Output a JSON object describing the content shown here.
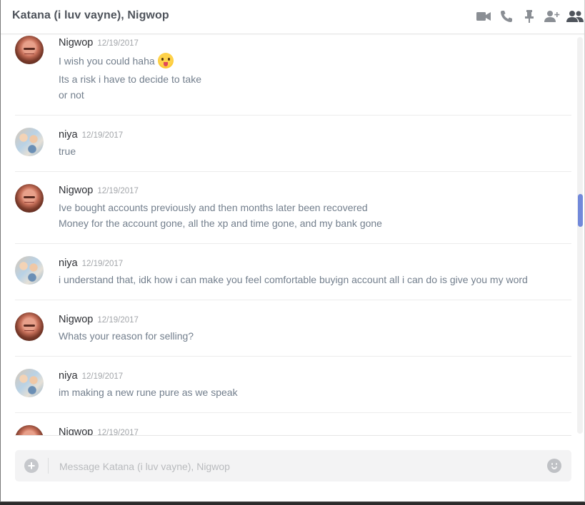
{
  "header": {
    "title": "Katana (i luv vayne), Nigwop",
    "icons": [
      "video-call-icon",
      "voice-call-icon",
      "pin-icon",
      "add-friend-icon",
      "members-icon"
    ]
  },
  "messages": [
    {
      "author": "Nigwop",
      "timestamp": "12/19/2017",
      "avatar": "nigwop",
      "lines": [
        "I wish you could haha",
        "Its a risk i have to decide to take",
        "or not"
      ],
      "emoji": "stuck-out-tongue-emoji"
    },
    {
      "author": "niya",
      "timestamp": "12/19/2017",
      "avatar": "niya",
      "lines": [
        "true"
      ]
    },
    {
      "author": "Nigwop",
      "timestamp": "12/19/2017",
      "avatar": "nigwop",
      "lines": [
        "Ive bought accounts previously and then months later been recovered",
        "Money for the account gone, all the xp and time gone, and my bank gone"
      ]
    },
    {
      "author": "niya",
      "timestamp": "12/19/2017",
      "avatar": "niya",
      "lines": [
        "i understand that, idk how i can make you feel comfortable buyign account all i can do is give you my word"
      ]
    },
    {
      "author": "Nigwop",
      "timestamp": "12/19/2017",
      "avatar": "nigwop",
      "lines": [
        "Whats your reason for selling?"
      ]
    },
    {
      "author": "niya",
      "timestamp": "12/19/2017",
      "avatar": "niya",
      "lines": [
        "im making a new rune pure as we speak"
      ]
    },
    {
      "author": "Nigwop",
      "timestamp": "12/19/2017",
      "avatar": "nigwop",
      "lines": []
    }
  ],
  "composer": {
    "placeholder": "Message Katana (i luv vayne), Nigwop",
    "value": ""
  },
  "colors": {
    "accent": "#7289da",
    "author": "#2f3136",
    "message_text": "#737f8d",
    "timestamp": "#a3a6aa"
  }
}
